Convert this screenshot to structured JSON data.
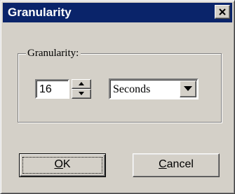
{
  "window": {
    "title": "Granularity"
  },
  "group": {
    "label": "Granularity:"
  },
  "granularity": {
    "value": "16",
    "unit": "Seconds"
  },
  "buttons": {
    "ok_mnemonic": "O",
    "ok_rest": "K",
    "cancel_mnemonic": "C",
    "cancel_rest": "ancel"
  },
  "icons": {
    "close": "close-icon",
    "spin_up": "arrow-up-icon",
    "spin_down": "arrow-down-icon",
    "dropdown": "chevron-down-icon"
  },
  "colors": {
    "titlebar": "#0a246a",
    "face": "#d4d0c8"
  }
}
